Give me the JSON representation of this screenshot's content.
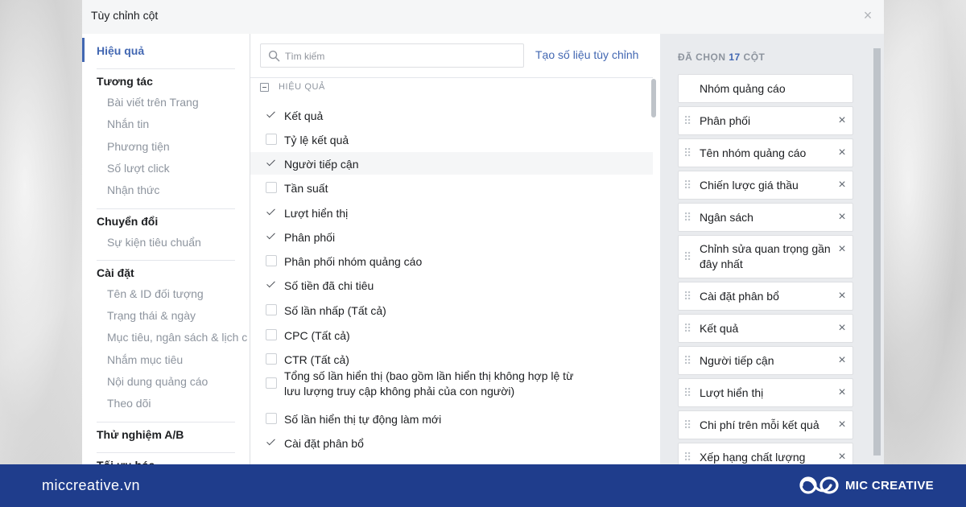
{
  "dialog": {
    "title": "Tùy chỉnh cột",
    "close_icon": "close-icon"
  },
  "nav": {
    "sections": [
      {
        "label": "Hiệu quả",
        "active": true,
        "items": []
      },
      {
        "label": "Tương tác",
        "items": [
          "Bài viết trên Trang",
          "Nhắn tin",
          "Phương tiện",
          "Số lượt click",
          "Nhận thức"
        ]
      },
      {
        "label": "Chuyển đổi",
        "items": [
          "Sự kiện tiêu chuẩn"
        ]
      },
      {
        "label": "Cài đặt",
        "items": [
          "Tên & ID đối tượng",
          "Trạng thái & ngày",
          "Mục tiêu, ngân sách & lịch c",
          "Nhắm mục tiêu",
          "Nội dung quảng cáo",
          "Theo dõi"
        ]
      },
      {
        "label": "Thử nghiệm A/B",
        "items": []
      },
      {
        "label": "Tối ưu hóa",
        "items": []
      }
    ]
  },
  "search": {
    "placeholder": "Tìm kiếm",
    "value": ""
  },
  "custom_metric_link": "Tạo số liệu tùy chỉnh",
  "metrics_section": {
    "label": "HIỆU QUẢ",
    "items": [
      {
        "label": "Kết quả",
        "checked": true
      },
      {
        "label": "Tỷ lệ kết quả",
        "checked": false
      },
      {
        "label": "Người tiếp cận",
        "checked": true
      },
      {
        "label": "Tần suất",
        "checked": false
      },
      {
        "label": "Lượt hiển thị",
        "checked": true
      },
      {
        "label": "Phân phối",
        "checked": true
      },
      {
        "label": "Phân phối nhóm quảng cáo",
        "checked": false
      },
      {
        "label": "Số tiền đã chi tiêu",
        "checked": true
      },
      {
        "label": "Số lần nhấp (Tất cả)",
        "checked": false
      },
      {
        "label": "CPC (Tất cả)",
        "checked": false
      },
      {
        "label": "CTR (Tất cả)",
        "checked": false
      },
      {
        "label": "Tổng số lần hiển thị (bao gồm lần hiển thị không hợp lệ từ lưu lượng truy cập không phải của con người)",
        "checked": false
      },
      {
        "label": "Số lần hiển thị tự động làm mới",
        "checked": false
      },
      {
        "label": "Cài đặt phân bổ",
        "checked": true
      }
    ]
  },
  "selected": {
    "title_prefix": "ĐÃ CHỌN",
    "count": "17",
    "title_suffix": "CỘT",
    "items": [
      {
        "label": "Nhóm quảng cáo",
        "fixed": true
      },
      {
        "label": "Phân phối"
      },
      {
        "label": "Tên nhóm quảng cáo"
      },
      {
        "label": "Chiến lược giá thầu"
      },
      {
        "label": "Ngân sách"
      },
      {
        "label": "Chỉnh sửa quan trọng gần đây nhất"
      },
      {
        "label": "Cài đặt phân bổ"
      },
      {
        "label": "Kết quả"
      },
      {
        "label": "Người tiếp cận"
      },
      {
        "label": "Lượt hiển thị"
      },
      {
        "label": "Chi phí trên mỗi kết quả"
      },
      {
        "label": "Xếp hạng chất lượng"
      }
    ]
  },
  "footer": {
    "site": "miccreative.vn",
    "brand": "MIC CREATIVE",
    "background": "#1f3d8c"
  },
  "colors": {
    "accent": "#4267b2",
    "muted": "#8d949e"
  }
}
